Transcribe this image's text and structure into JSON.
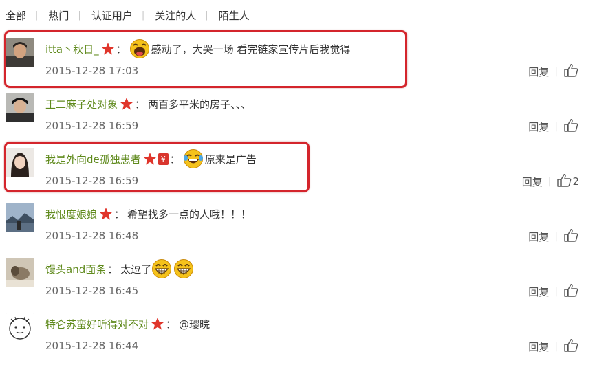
{
  "tabs": [
    "全部",
    "热门",
    "认证用户",
    "关注的人",
    "陌生人"
  ],
  "comments": [
    {
      "user": "itta丶秋日_",
      "text": "感动了，大哭一场 看完链家宣传片后我觉得",
      "time": "2015-12-28 17:03",
      "reply": "回复",
      "likes": "",
      "emoji": [
        "laugh-cry-face"
      ]
    },
    {
      "user": "王二麻子处对象",
      "text": "两百多平米的房子、、、",
      "time": "2015-12-28 16:59",
      "reply": "回复",
      "likes": ""
    },
    {
      "user": "我是外向de孤独患者",
      "text": "原来是广告",
      "time": "2015-12-28 16:59",
      "reply": "回复",
      "likes": "2",
      "emoji": [
        "tears-of-joy-face"
      ],
      "badge_red": "¥"
    },
    {
      "user": "我恨度娘娘",
      "text": "希望找多一点的人哦！！！",
      "time": "2015-12-28 16:48",
      "reply": "回复",
      "likes": ""
    },
    {
      "user": "馒头and面条",
      "text": "太逗了",
      "time": "2015-12-28 16:45",
      "reply": "回复",
      "likes": "",
      "emoji": [
        "grin-face",
        "grin-face"
      ]
    },
    {
      "user": "特仑苏蛮好听得对不对",
      "text": "@璎晥",
      "time": "2015-12-28 16:44",
      "reply": "回复",
      "likes": ""
    }
  ],
  "colon": "：",
  "separator": "|",
  "colors": {
    "username": "#5f8a1c",
    "highlight": "#d4252c",
    "star": "#e0352b"
  }
}
